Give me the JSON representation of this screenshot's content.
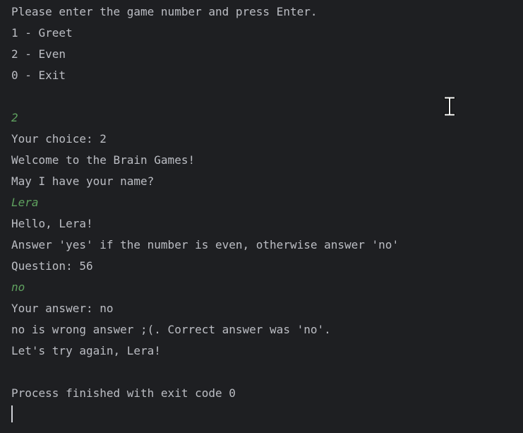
{
  "console": {
    "lines": [
      {
        "text": "Please enter the game number and press Enter.",
        "kind": "output"
      },
      {
        "text": "1 - Greet",
        "kind": "output"
      },
      {
        "text": "2 - Even",
        "kind": "output"
      },
      {
        "text": "0 - Exit",
        "kind": "output"
      },
      {
        "text": "",
        "kind": "blank"
      },
      {
        "text": "2",
        "kind": "input"
      },
      {
        "text": "Your choice: 2",
        "kind": "output"
      },
      {
        "text": "Welcome to the Brain Games!",
        "kind": "output"
      },
      {
        "text": "May I have your name?",
        "kind": "output"
      },
      {
        "text": "Lera",
        "kind": "input"
      },
      {
        "text": "Hello, Lera!",
        "kind": "output"
      },
      {
        "text": "Answer 'yes' if the number is even, otherwise answer 'no'",
        "kind": "output"
      },
      {
        "text": "Question: 56",
        "kind": "output"
      },
      {
        "text": "no",
        "kind": "input"
      },
      {
        "text": "Your answer: no",
        "kind": "output"
      },
      {
        "text": "no is wrong answer ;(. Correct answer was 'no'.",
        "kind": "output"
      },
      {
        "text": "Let's try again, Lera!",
        "kind": "output"
      },
      {
        "text": "",
        "kind": "blank"
      },
      {
        "text": "Process finished with exit code 0",
        "kind": "output"
      }
    ]
  },
  "colors": {
    "background": "#1e1f22",
    "output_text": "#bcbec4",
    "user_input_text": "#5fa15f"
  },
  "icons": {
    "mouse_pointer": "text-cursor-ibeam-icon"
  }
}
